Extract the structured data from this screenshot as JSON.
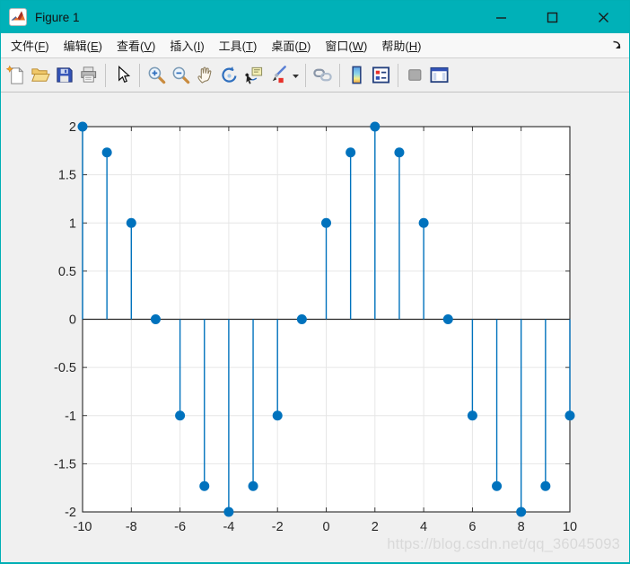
{
  "window": {
    "title": "Figure 1",
    "controls": {
      "minimize": "minimize",
      "maximize": "maximize",
      "close": "close"
    }
  },
  "menu": {
    "items": [
      {
        "text": "文件",
        "key": "F"
      },
      {
        "text": "编辑",
        "key": "E"
      },
      {
        "text": "查看",
        "key": "V"
      },
      {
        "text": "插入",
        "key": "I"
      },
      {
        "text": "工具",
        "key": "T"
      },
      {
        "text": "桌面",
        "key": "D"
      },
      {
        "text": "窗口",
        "key": "W"
      },
      {
        "text": "帮助",
        "key": "H"
      }
    ]
  },
  "toolbar": {
    "icons": [
      "new-figure",
      "open-file",
      "save-figure",
      "print-figure",
      "sep",
      "pointer",
      "sep",
      "zoom-in",
      "zoom-out",
      "pan",
      "rotate-3d",
      "data-cursor",
      "brush",
      "brush-dropdown",
      "sep",
      "link-plot",
      "sep",
      "insert-colorbar",
      "insert-legend",
      "sep",
      "hide-plot-tools",
      "show-plot-tools"
    ]
  },
  "colors": {
    "titlebar_teal": "#00b1b8",
    "figure_bg": "#f0f0f0",
    "plot_bg": "#ffffff",
    "stem_blue": "#0072BD",
    "axes_dark": "#262626",
    "grid_gray": "#e6e6e6"
  },
  "watermark": "https://blog.csdn.net/qq_36045093",
  "chart_data": {
    "type": "stem",
    "x": [
      -10,
      -9,
      -8,
      -7,
      -6,
      -5,
      -4,
      -3,
      -2,
      -1,
      0,
      1,
      2,
      3,
      4,
      5,
      6,
      7,
      8,
      9,
      10
    ],
    "y": [
      2,
      1.7321,
      1,
      0,
      -1,
      -1.7321,
      -2,
      -1.7321,
      -1,
      0,
      1,
      1.7321,
      2,
      1.7321,
      1,
      0,
      -1,
      -1.7321,
      -2,
      -1.7321,
      -1
    ],
    "title": "",
    "xlabel": "",
    "ylabel": "",
    "xlim": [
      -10,
      10
    ],
    "ylim": [
      -2,
      2
    ],
    "xticks": [
      -10,
      -8,
      -6,
      -4,
      -2,
      0,
      2,
      4,
      6,
      8,
      10
    ],
    "yticks": [
      -2,
      -1.5,
      -1,
      -0.5,
      0,
      0.5,
      1,
      1.5,
      2
    ],
    "grid": true,
    "baseline": 0,
    "markers_filled": true,
    "legend_position": "none"
  }
}
